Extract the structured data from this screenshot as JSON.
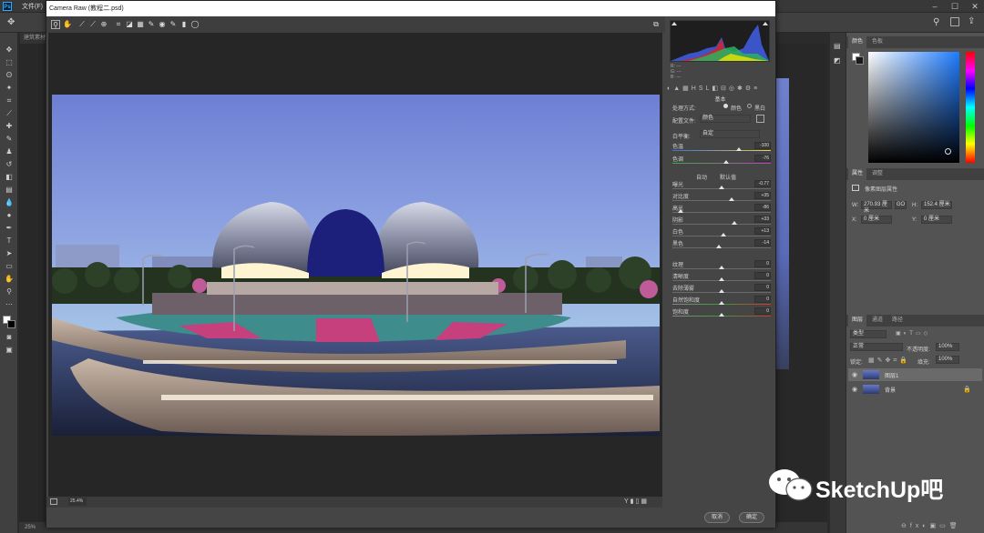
{
  "photoshop": {
    "file_menu": "文件(F)",
    "doc_tab": "建筑素材",
    "status_zoom": "25%",
    "panels": {
      "color_tabs": [
        "颜色",
        "色板"
      ],
      "properties_tabs": [
        "属性",
        "调整"
      ],
      "properties_title": "像素图层属性",
      "w_label": "W:",
      "w_value": "270.93 厘米",
      "link_label": "GO",
      "h_label": "H:",
      "h_value": "152.4 厘米",
      "x_label": "X:",
      "x_value": "0 厘米",
      "y_label": "Y:",
      "y_value": "0 厘米",
      "layers_tabs": [
        "图层",
        "通道",
        "路径"
      ],
      "filter_kind": "类型",
      "blend_mode": "正常",
      "opacity_label": "不透明度:",
      "opacity_value": "100%",
      "lock_label": "锁定:",
      "fill_label": "填充:",
      "fill_value": "100%",
      "layers": [
        {
          "name": "图层1"
        },
        {
          "name": "背景"
        }
      ]
    }
  },
  "camera_raw": {
    "title": "Camera Raw (教程二.psd)",
    "zoom": "25.4%",
    "cancel_label": "取消",
    "ok_label": "确定",
    "histogram": {
      "rgb_rows": [
        "R:",
        "G:",
        "B:"
      ],
      "rgb_values": [
        "---",
        "---",
        "---"
      ]
    },
    "panel_title": "基本",
    "treatment_label": "处理方式:",
    "color_option": "颜色",
    "bw_option": "黑白",
    "profile_label": "配置文件:",
    "profile_value": "颜色",
    "wb_label": "白平衡:",
    "wb_value": "自定",
    "auto_label": "自动",
    "default_label": "默认值",
    "sliders_top": [
      {
        "label": "色温",
        "value": "-100",
        "pos": 0.68
      },
      {
        "label": "色调",
        "value": "-76",
        "pos": 0.55
      }
    ],
    "sliders_tone": [
      {
        "label": "曝光",
        "value": "-0.77",
        "pos": 0.5
      },
      {
        "label": "对比度",
        "value": "+35",
        "pos": 0.6
      },
      {
        "label": "高光",
        "value": "-86",
        "pos": 0.08
      },
      {
        "label": "阴影",
        "value": "+33",
        "pos": 0.63
      },
      {
        "label": "白色",
        "value": "+13",
        "pos": 0.52
      },
      {
        "label": "黑色",
        "value": "-14",
        "pos": 0.47
      }
    ],
    "sliders_presence": [
      {
        "label": "纹理",
        "value": "0",
        "pos": 0.5
      },
      {
        "label": "清晰度",
        "value": "0",
        "pos": 0.5
      },
      {
        "label": "去除薄雾",
        "value": "0",
        "pos": 0.5
      },
      {
        "label": "自然饱和度",
        "value": "0",
        "pos": 0.5
      },
      {
        "label": "饱和度",
        "value": "0",
        "pos": 0.5
      }
    ]
  },
  "watermark": {
    "text": "SketchUp吧"
  },
  "colors": {
    "accent": "#31a8ff",
    "sky_top": "#6e7fd4",
    "sky_bottom": "#a4c2e6",
    "dome": "#9aa0b8",
    "dome_glass": "#1c207a",
    "plaza_pink": "#c6407e",
    "plaza_teal": "#3e8c8c"
  }
}
